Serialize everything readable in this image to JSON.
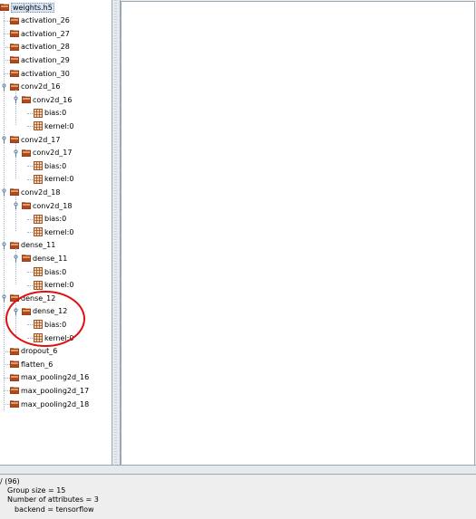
{
  "tree": {
    "root": "weights.h5",
    "groups": [
      {
        "label": "activation_26"
      },
      {
        "label": "activation_27"
      },
      {
        "label": "activation_28"
      },
      {
        "label": "activation_29"
      },
      {
        "label": "activation_30"
      },
      {
        "label": "conv2d_16",
        "sub": "conv2d_16",
        "datasets": [
          "bias:0",
          "kernel:0"
        ]
      },
      {
        "label": "conv2d_17",
        "sub": "conv2d_17",
        "datasets": [
          "bias:0",
          "kernel:0"
        ]
      },
      {
        "label": "conv2d_18",
        "sub": "conv2d_18",
        "datasets": [
          "bias:0",
          "kernel:0"
        ]
      },
      {
        "label": "dense_11",
        "sub": "dense_11",
        "datasets": [
          "bias:0",
          "kernel:0"
        ]
      },
      {
        "label": "dense_12",
        "sub": "dense_12",
        "datasets": [
          "bias:0",
          "kernel:0"
        ]
      },
      {
        "label": "dropout_6"
      },
      {
        "label": "flatten_6"
      },
      {
        "label": "max_pooling2d_16"
      },
      {
        "label": "max_pooling2d_17"
      },
      {
        "label": "max_pooling2d_18"
      }
    ]
  },
  "info": {
    "header": "/ (96)",
    "group_size": "Group size = 15",
    "num_attrs": "Number of attributes = 3",
    "backend": "backend = tensorflow"
  },
  "colors": {
    "folder_body": "#b5471f",
    "folder_top": "#d9a066",
    "dataset": "#a0522d",
    "annotation": "#e01010",
    "selection_bg": "#d7e4f3"
  },
  "icons": {
    "root": "root-folder-icon",
    "group": "folder-icon",
    "dataset": "dataset-grid-icon",
    "expander": "expander-icon"
  }
}
